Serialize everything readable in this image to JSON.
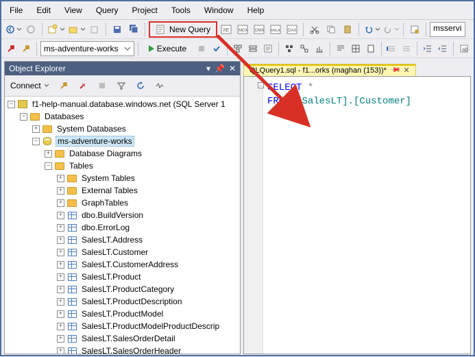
{
  "menu": [
    "File",
    "Edit",
    "View",
    "Query",
    "Project",
    "Tools",
    "Window",
    "Help"
  ],
  "toolbar1": {
    "new_query_label": "New Query",
    "conn_box": "msservi"
  },
  "toolbar2": {
    "db_selected": "ms-adventure-works",
    "execute_label": "Execute"
  },
  "oe": {
    "title": "Object Explorer",
    "connect_label": "Connect",
    "tree": {
      "server": "f1-help-manual.database.windows.net (SQL Server 1",
      "databases": "Databases",
      "sys_db": "System Databases",
      "db": "ms-adventure-works",
      "diagrams": "Database Diagrams",
      "tables": "Tables",
      "sys_tables": "System Tables",
      "ext_tables": "External Tables",
      "graph_tables": "GraphTables",
      "items": [
        "dbo.BuildVersion",
        "dbo.ErrorLog",
        "SalesLT.Address",
        "SalesLT.Customer",
        "SalesLT.CustomerAddress",
        "SalesLT.Product",
        "SalesLT.ProductCategory",
        "SalesLT.ProductDescription",
        "SalesLT.ProductModel",
        "SalesLT.ProductModelProductDescrip",
        "SalesLT.SalesOrderDetail",
        "SalesLT.SalesOrderHeader"
      ]
    }
  },
  "editor": {
    "tab_label": "QLQuery1.sql - f1...orks (maghan (153))*",
    "code_line1_kw": "SELECT",
    "code_line1_rest": " *",
    "code_line2_kw": "FROM",
    "code_line2_obj": " [SalesLT].[Customer]"
  }
}
